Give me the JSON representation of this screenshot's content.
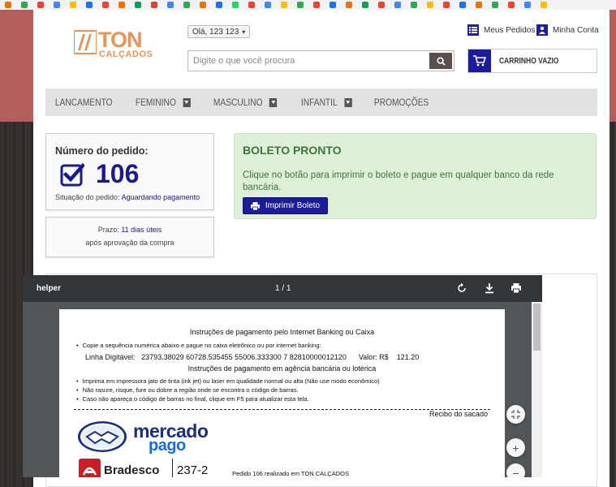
{
  "colors": {
    "brand_orange": "#e3955a",
    "brand_blue": "#1a1a8f",
    "success_green": "#3c763d",
    "success_bg": "#dff0d8",
    "nav_bg": "#e2e2e2"
  },
  "header": {
    "logo_text": "TON",
    "logo_subtext": "CALÇADOS",
    "greeting": "Olá, 123 123",
    "search_placeholder": "Digite o que você procura",
    "search_icon": "search-icon",
    "meus_pedidos": "Meus Pedidos",
    "minha_conta": "Minha Conta",
    "cart_label": "CARRINHO VAZIO"
  },
  "nav": {
    "items": [
      {
        "label": "LANCAMENTO",
        "dropdown": false
      },
      {
        "label": "FEMININO",
        "dropdown": true
      },
      {
        "label": "MASCULINO",
        "dropdown": true
      },
      {
        "label": "INFANTIL",
        "dropdown": true
      },
      {
        "label": "PROMOÇÕES",
        "dropdown": false
      }
    ]
  },
  "order": {
    "title": "Número do pedido:",
    "number": "106",
    "status_label": "Situação do pedido:",
    "status_value": "Aguardando pagamento",
    "prazo_label": "Prazo:",
    "prazo_value": "11 dias úteis",
    "prazo_note": "após aprovação da compra"
  },
  "boleto": {
    "title": "BOLETO PRONTO",
    "text": "Clique no botão para imprimir o boleto e pague em qualquer banco da rede bancária.",
    "button": "Imprimir Boleto"
  },
  "pdf": {
    "title": "helper",
    "pages": "1 / 1",
    "heading1": "Instruções de pagamento pelo Internet Banking ou Caixa",
    "bullet1": "Copie a sequência numérica abaixo e pague no caixa eletrônico ou por internet banking:",
    "linha_label": "Linha Digitável:",
    "linha_value": "23793.38029 60728.535455 55006.333300 7 82810000012120",
    "valor_label": "Valor: R$",
    "valor_value": "121.20",
    "heading2": "Instruções de pagamento em agência bancária ou lotérica",
    "bullet2": "Imprima em impressora jato de tinta (ink jet) ou laser em qualidade normal ou alta (Não use modo econômico)",
    "bullet3": "Não rasure, risque, fure ou dobre a região onde se encontra o código de barras.",
    "bullet4": "Caso não apareça o código de barras no final, clique em F5 para atualizar esta tela.",
    "recibo": "Recibo do sacado",
    "mp_word1": "mercado",
    "mp_word2": "pago",
    "bank_name": "Bradesco",
    "bank_code": "237-2",
    "pedido_line": "Pedido 106 realizado em TON CALÇADOS",
    "zoom_in": "+",
    "zoom_out": "−"
  }
}
